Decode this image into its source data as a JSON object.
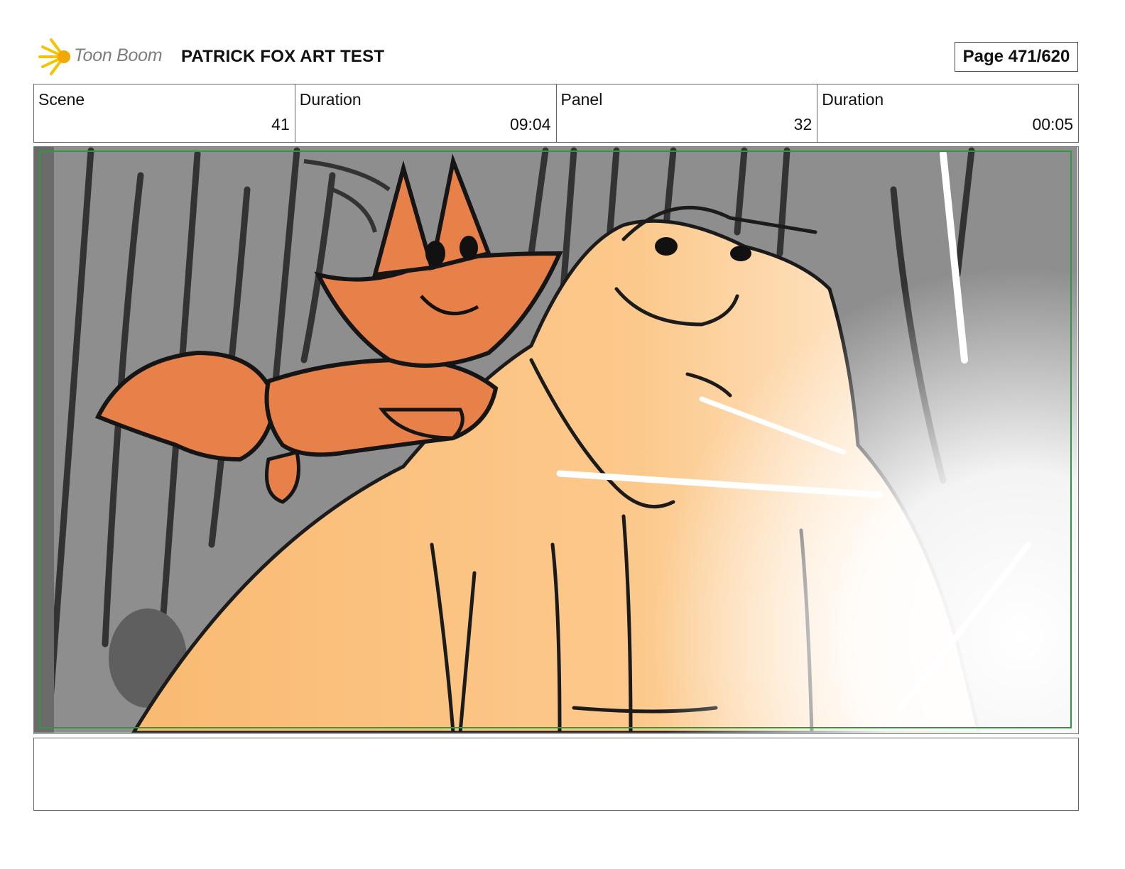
{
  "header": {
    "logo_text": "Toon Boom",
    "title": "PATRICK FOX ART TEST",
    "page": "Page 471/620"
  },
  "info": {
    "scene_label": "Scene",
    "scene_value": "41",
    "scene_duration_label": "Duration",
    "scene_duration_value": "09:04",
    "panel_label": "Panel",
    "panel_value": "32",
    "panel_duration_label": "Duration",
    "panel_duration_value": "00:05"
  },
  "notes": {
    "text": ""
  },
  "colors": {
    "fox": "#e8804a",
    "bear": "#fbc07f",
    "background": "#8c8c8c",
    "frame_border": "#2f9a3a"
  }
}
